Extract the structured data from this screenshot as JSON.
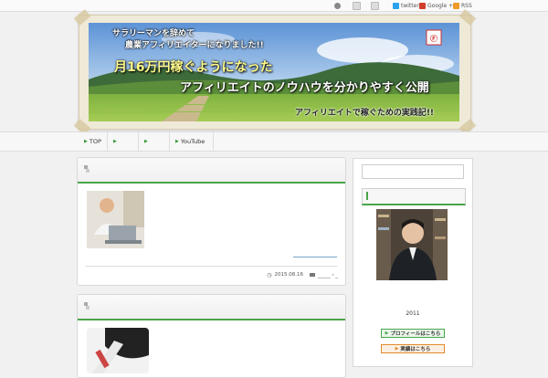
{
  "topbar": {
    "links": [
      {
        "label": "",
        "icon": "person-icon"
      },
      {
        "label": "",
        "icon": "rss-small-icon"
      },
      {
        "label": "",
        "icon": "bookmark-icon"
      },
      {
        "label": "twitter",
        "icon": "twitter-icon"
      },
      {
        "label": "Google +1",
        "icon": "google-plus-icon"
      },
      {
        "label": "RSS",
        "icon": "rss-icon"
      }
    ]
  },
  "banner": {
    "line1": "サラリーマンを辞めて",
    "line2": "農業アフィリエイターになりました!!",
    "line3": "月16万円稼ぐようになった",
    "line4": "アフィリエイトのノウハウを分かりやすく公開",
    "line5": "アフィリエイトで稼ぐための実践記!!"
  },
  "nav": {
    "items": [
      {
        "label": "TOP"
      },
      {
        "label": ""
      },
      {
        "label": ""
      },
      {
        "label": "YouTube"
      }
    ]
  },
  "post1": {
    "date": "2015.08.16",
    "category": "_____・_"
  },
  "sidebar": {
    "profile_year": "2011",
    "profile_button": "プロフィールはこちら",
    "results_button": "実績はこちら"
  },
  "colors": {
    "accent_green": "#49a54a",
    "button_orange": "#e08a2a"
  }
}
